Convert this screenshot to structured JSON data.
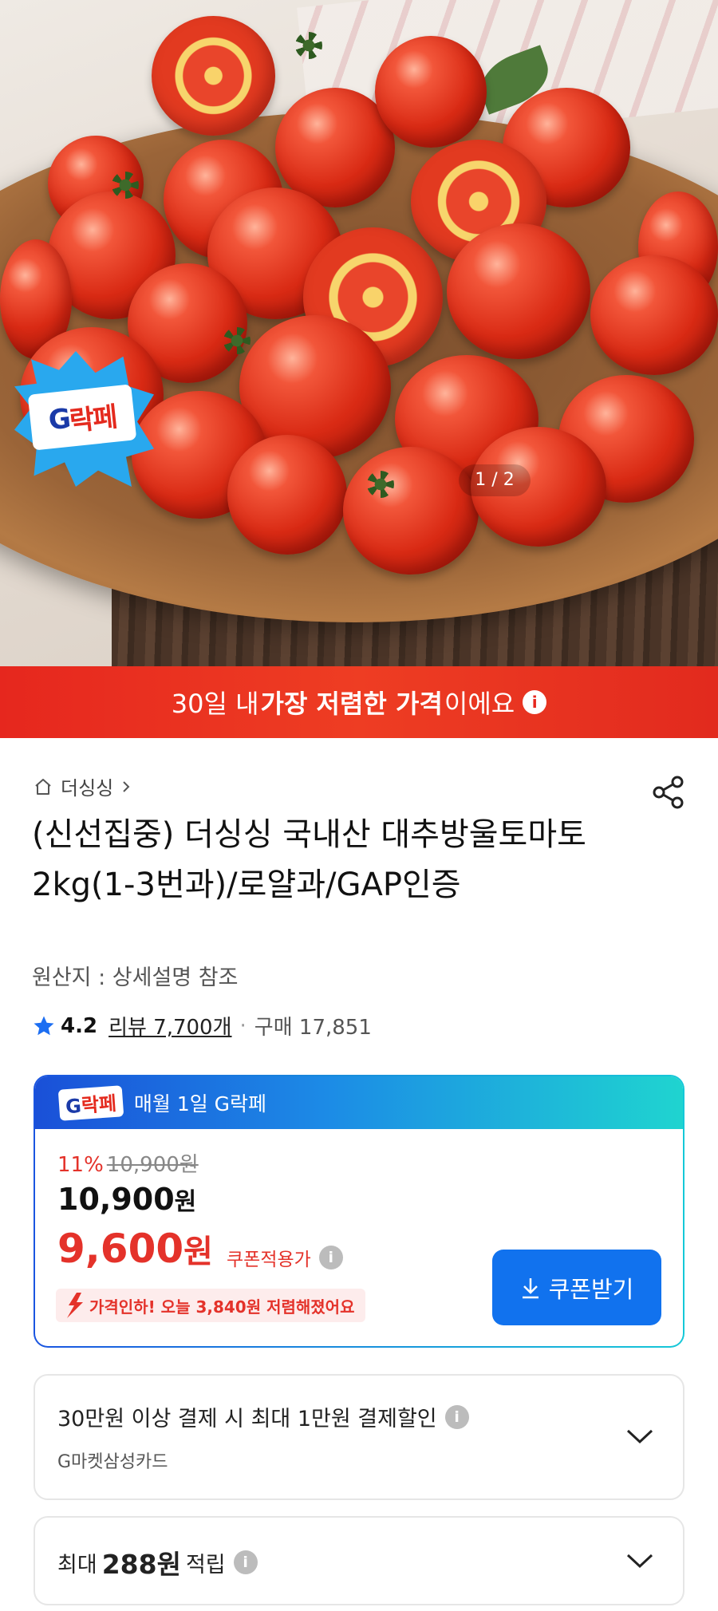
{
  "hero": {
    "badge_text_a": "G",
    "badge_text_b": "락페",
    "counter": "1 / 2"
  },
  "banner": {
    "pre": "30일 내 ",
    "bold": "가장 저렴한 가격",
    "post": "이에요"
  },
  "breadcrumb": {
    "store": "더싱싱"
  },
  "product": {
    "title": "(신선집중) 더싱싱 국내산 대추방울토마토 2kg(1-3번과)/로얄과/GAP인증",
    "origin": "원산지 : 상세설명 참조",
    "rating": "4.2",
    "review": "리뷰 7,700개",
    "purchase": "구매 17,851"
  },
  "g_event": {
    "logo_a": "G",
    "logo_b": "락페",
    "header": "매월 1일 G락페",
    "discount_pct": "11%",
    "strike_price": "10,900원",
    "price_num": "10,900",
    "price_unit": "원",
    "sale_num": "9,600",
    "sale_unit": "원",
    "coupon_label": "쿠폰적용가",
    "price_drop": "가격인하! 오늘 3,840원 저렴해졌어요",
    "coupon_button": "쿠폰받기"
  },
  "payment_discount": {
    "title": "30만원 이상 결제 시 최대 1만원 결제할인",
    "card": "G마켓삼성카드"
  },
  "points": {
    "pre": "최대",
    "amount": "288원",
    "post": "적립"
  },
  "colors": {
    "accent_red": "#e4322a",
    "banner_red": "#e6271e",
    "coupon_blue": "#1172ee"
  }
}
